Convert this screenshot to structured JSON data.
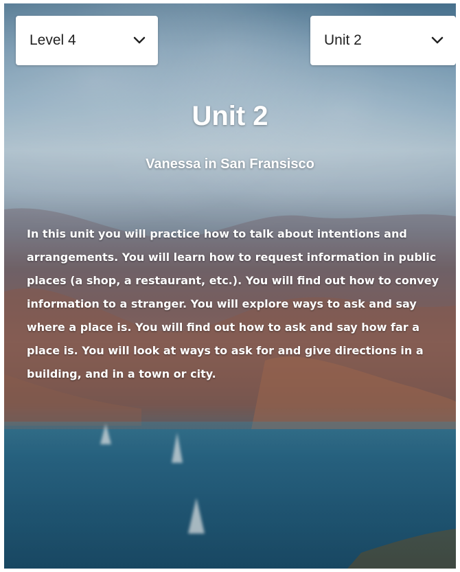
{
  "level_select": {
    "value": "Level 4",
    "icon": "chevron-down-icon"
  },
  "unit_select": {
    "value": "Unit 2",
    "icon": "chevron-down-icon"
  },
  "unit": {
    "title": "Unit 2",
    "subtitle": "Vanessa in San Fransisco",
    "description": "In this unit you will practice how to talk about intentions and arrangements. You will learn how to request information in public places (a shop, a restaurant, etc.). You will find out how to convey information to a stranger. You will explore ways to ask and say where a place is. You will find out how to ask and say how far a place is. You will look at ways to ask for and give directions in a building, and in a town or city."
  },
  "colors": {
    "text_on_image": "#ffffff",
    "select_background": "#ffffff",
    "select_text": "#222222"
  }
}
